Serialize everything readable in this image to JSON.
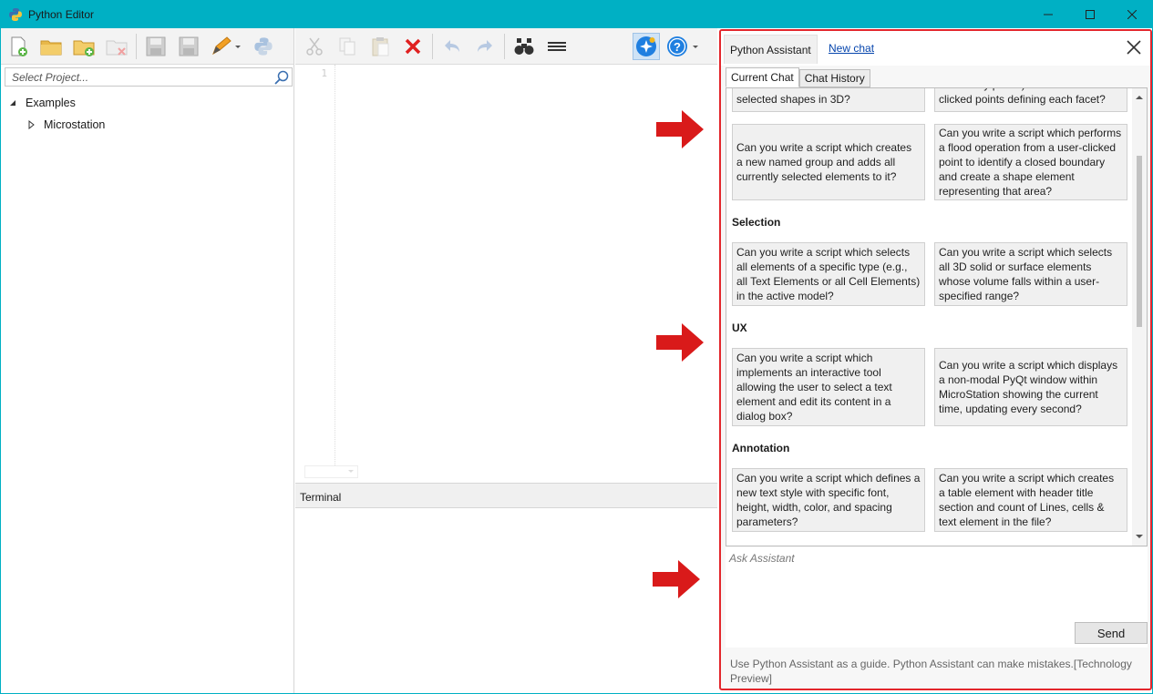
{
  "window": {
    "title": "Python Editor"
  },
  "left": {
    "project_placeholder": "Select Project...",
    "tree": [
      {
        "label": "Examples",
        "expanded": true
      },
      {
        "label": "Microstation",
        "expanded": false
      }
    ]
  },
  "editor": {
    "line_number": "1"
  },
  "terminal": {
    "label": "Terminal"
  },
  "assistant": {
    "tab_label": "Python Assistant",
    "new_chat": "New chat",
    "subtabs": [
      "Current Chat",
      "Chat History"
    ],
    "cards_top": [
      "selected shapes in 3D?",
      "defined by points) based on user-clicked points defining each facet?"
    ],
    "cards_group1": [
      "Can you write a script which creates a new named group and adds all currently selected elements to it?",
      "Can you write a script which performs a flood operation from a user-clicked point to identify a closed boundary and create a shape element representing that area?"
    ],
    "sections": [
      {
        "title": "Selection",
        "cards": [
          "Can you write a script which selects all elements of a specific type (e.g., all Text Elements or all Cell Elements) in the active model?",
          "Can you write a script which selects all 3D solid or surface elements whose volume falls within a user-specified range?"
        ]
      },
      {
        "title": "UX",
        "cards": [
          "Can you write a script which implements an interactive tool allowing the user to select a text element and edit its content in a dialog box?",
          "Can you write a script which displays a non-modal PyQt window within MicroStation showing the current time, updating every second?"
        ]
      },
      {
        "title": "Annotation",
        "cards": [
          "Can you write a script which defines a new text style with specific font, height, width, color, and spacing parameters?",
          "Can you write a script which creates a table element with header title section and count of Lines, cells & text element in the file?"
        ]
      }
    ],
    "ask_placeholder": "Ask Assistant",
    "send": "Send",
    "disclaimer": "Use Python Assistant as a guide. Python Assistant can make mistakes.[Technology Preview]"
  },
  "colors": {
    "titlebar": "#00b0c4",
    "highlight": "#e3262c",
    "arrow": "#d91a1a"
  }
}
